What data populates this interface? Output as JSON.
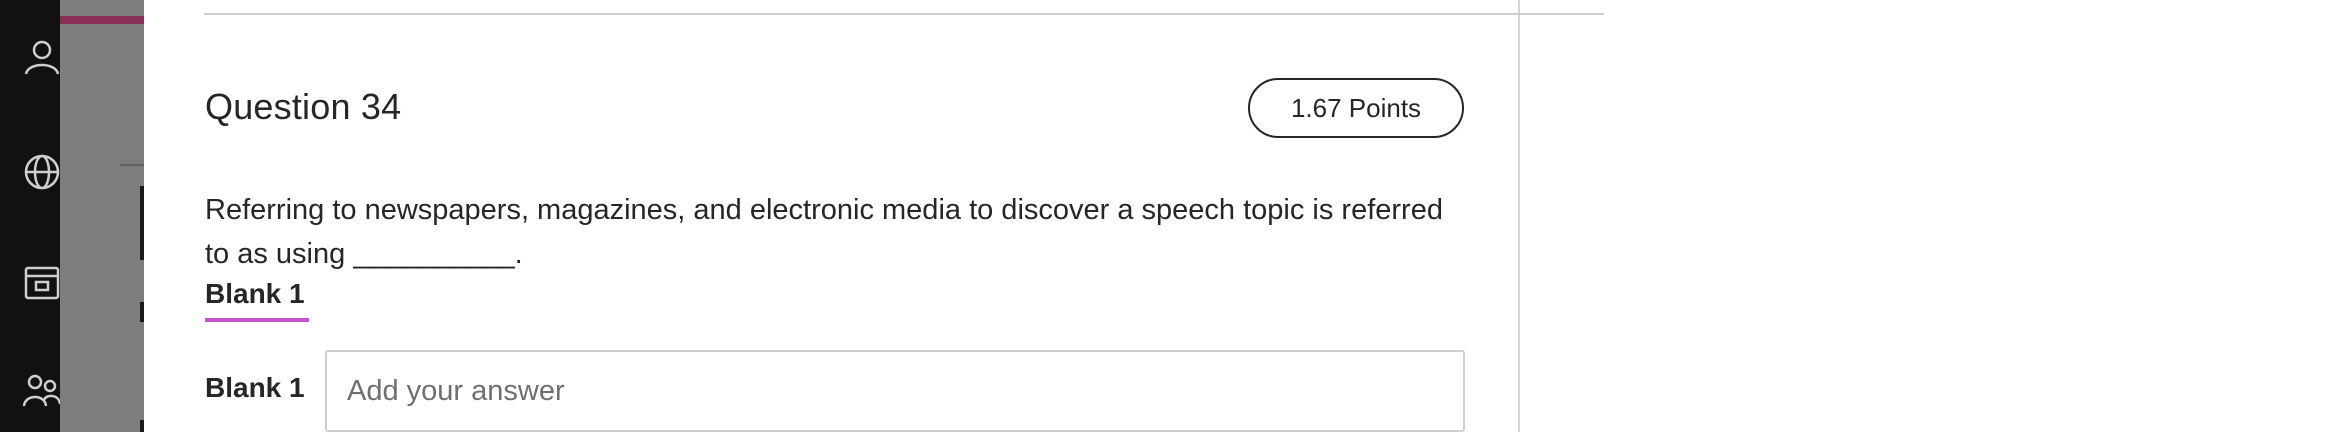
{
  "question": {
    "title": "Question 34",
    "points": "1.67 Points",
    "text": "Referring to newspapers, magazines, and electronic media to discover a speech topic is referred to as using __________.",
    "blank_tab_label": "Blank 1",
    "blank_field_label": "Blank 1",
    "answer_placeholder": "Add your answer",
    "answer_value": ""
  },
  "rail": {
    "icons": [
      "user-icon",
      "globe-icon",
      "calendar-icon",
      "people-icon"
    ]
  },
  "colors": {
    "rail": "#111111",
    "accent_underline": "#c452c9",
    "text": "#262626",
    "dim_accent": "#8a2f55"
  }
}
